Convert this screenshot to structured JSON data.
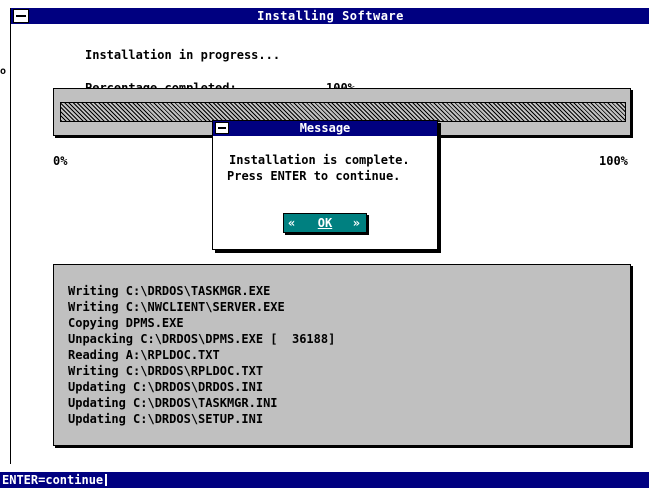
{
  "window": {
    "title": "Installing Software",
    "stray_glyph": "o"
  },
  "progress": {
    "heading": "Installation in progress...",
    "label": "Percentage completed:",
    "value_text": "100%",
    "fraction": 1.0,
    "scale_min": "0%",
    "scale_max": "100%"
  },
  "dialog": {
    "title": "Message",
    "line1": "Installation is complete.",
    "line2": "Press ENTER to continue.",
    "ok_label": "OK",
    "ok_left_glyph": "«",
    "ok_right_glyph": "»"
  },
  "log": {
    "lines": [
      "Writing C:\\DRDOS\\TASKMGR.EXE",
      "Writing C:\\NWCLIENT\\SERVER.EXE",
      "Copying DPMS.EXE",
      "Unpacking C:\\DRDOS\\DPMS.EXE [  36188]",
      "Reading A:\\RPLDOC.TXT",
      "Writing C:\\DRDOS\\RPLDOC.TXT",
      "Updating C:\\DRDOS\\DRDOS.INI",
      "Updating C:\\DRDOS\\TASKMGR.INI",
      "Updating C:\\DRDOS\\SETUP.INI"
    ]
  },
  "status": {
    "text": "ENTER=continue"
  },
  "colors": {
    "title_bar": "#000080",
    "panel": "#c0c0c0",
    "button": "#008080"
  }
}
